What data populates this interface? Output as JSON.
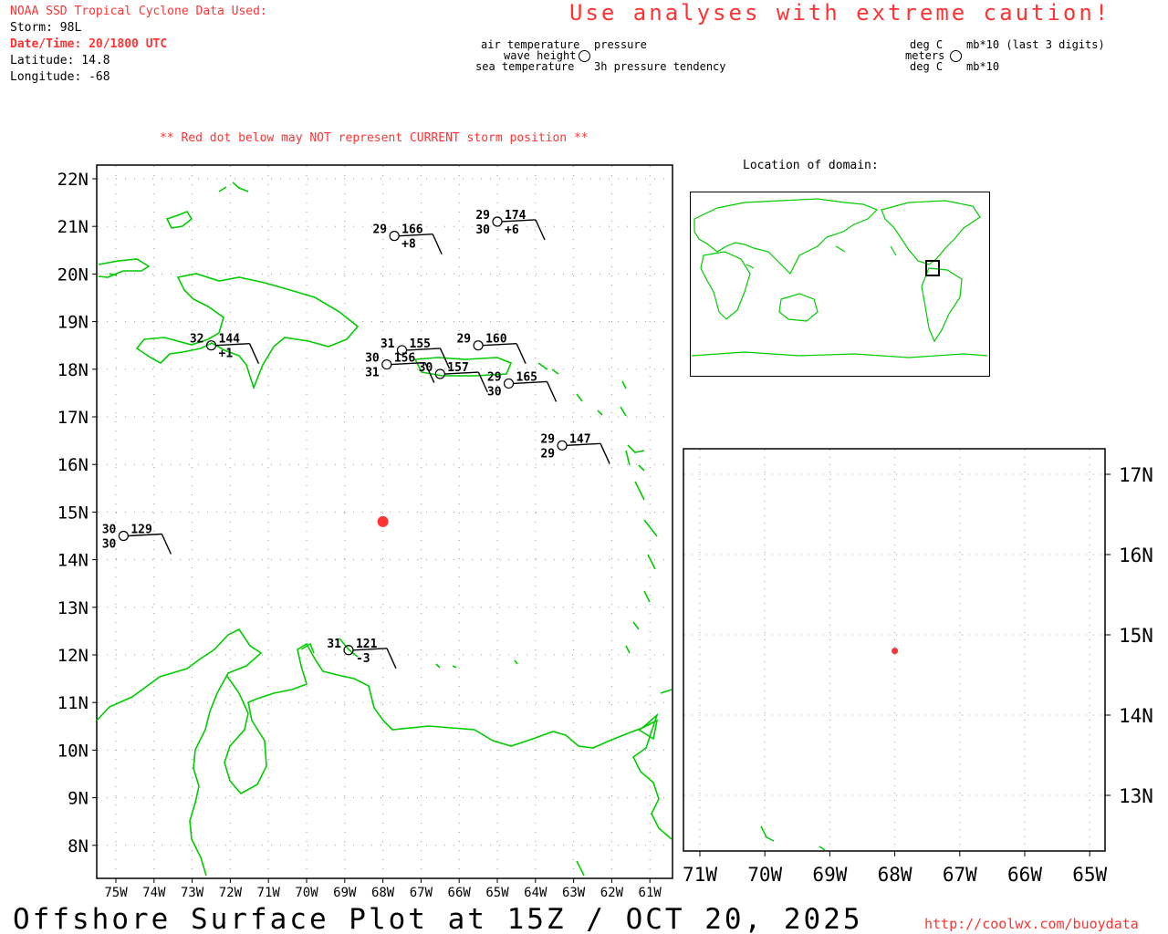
{
  "header": {
    "source_line": "NOAA SSD Tropical Cyclone Data Used:",
    "storm": "Storm: 98L",
    "datetime": "Date/Time: 20/1800 UTC",
    "latitude": "Latitude: 14.8",
    "longitude": "Longitude: -68"
  },
  "caution": "Use analyses with extreme caution!",
  "legend": {
    "air_temperature": "air temperature",
    "wave_height": "wave height",
    "sea_temperature": "sea temperature",
    "pressure": "pressure",
    "pressure_tendency": "3h pressure tendency",
    "unit_air": "deg C",
    "unit_wave": "meters",
    "unit_sea": "deg C",
    "unit_pressure": "mb*10 (last 3 digits)",
    "unit_tendency": "mb*10"
  },
  "warning": "** Red dot below may NOT represent CURRENT storm position **",
  "location_label": "Location of domain:",
  "footer_title": "Offshore Surface Plot at 15Z / OCT 20, 2025",
  "footer_url": "http://coolwx.com/buoydata",
  "colors": {
    "storm": "#ff3333",
    "land": "#00cc00",
    "stations": "#000000",
    "grid": "#999999"
  },
  "main_map": {
    "lon_labels": [
      "75W",
      "74W",
      "73W",
      "72W",
      "71W",
      "70W",
      "69W",
      "68W",
      "67W",
      "66W",
      "65W",
      "64W",
      "63W",
      "62W",
      "61W"
    ],
    "lat_labels": [
      "22N",
      "21N",
      "20N",
      "19N",
      "18N",
      "17N",
      "16N",
      "15N",
      "14N",
      "13N",
      "12N",
      "11N",
      "10N",
      "9N",
      "8N"
    ],
    "storm_lat": 14.8,
    "storm_lon": -68.0,
    "stations": [
      {
        "lat": 20.8,
        "lon": -67.7,
        "air": "29",
        "pressure": "166",
        "tendency": "+8"
      },
      {
        "lat": 21.1,
        "lon": -65.0,
        "air": "29",
        "pressure": "174",
        "sea": "30",
        "tendency": "+6"
      },
      {
        "lat": 18.5,
        "lon": -72.5,
        "air": "32",
        "pressure": "144",
        "tendency": "+1"
      },
      {
        "lat": 16.4,
        "lon": -63.3,
        "air": "29",
        "pressure": "147",
        "sea": "29"
      },
      {
        "lat": 14.5,
        "lon": -74.8,
        "air": "30",
        "pressure": "129",
        "sea": "30"
      },
      {
        "lat": 12.1,
        "lon": -68.9,
        "air": "31",
        "pressure": "121",
        "tendency": "-3"
      },
      {
        "lat": 18.1,
        "lon": -67.9,
        "air": "30",
        "pressure": "156",
        "sea": "31"
      },
      {
        "lat": 18.4,
        "lon": -67.5,
        "air": "31",
        "pressure": "155"
      },
      {
        "lat": 17.9,
        "lon": -66.5,
        "air": "30",
        "pressure": "157"
      },
      {
        "lat": 18.5,
        "lon": -65.5,
        "air": "29",
        "pressure": "160"
      },
      {
        "lat": 17.7,
        "lon": -64.7,
        "air": "29",
        "pressure": "165",
        "sea": "30"
      }
    ]
  },
  "inset_map": {
    "lon_labels": [
      "71W",
      "70W",
      "69W",
      "68W",
      "67W",
      "66W",
      "65W"
    ],
    "lat_labels": [
      "17N",
      "16N",
      "15N",
      "14N",
      "13N"
    ],
    "storm_lat": 14.8,
    "storm_lon": -68.0
  }
}
